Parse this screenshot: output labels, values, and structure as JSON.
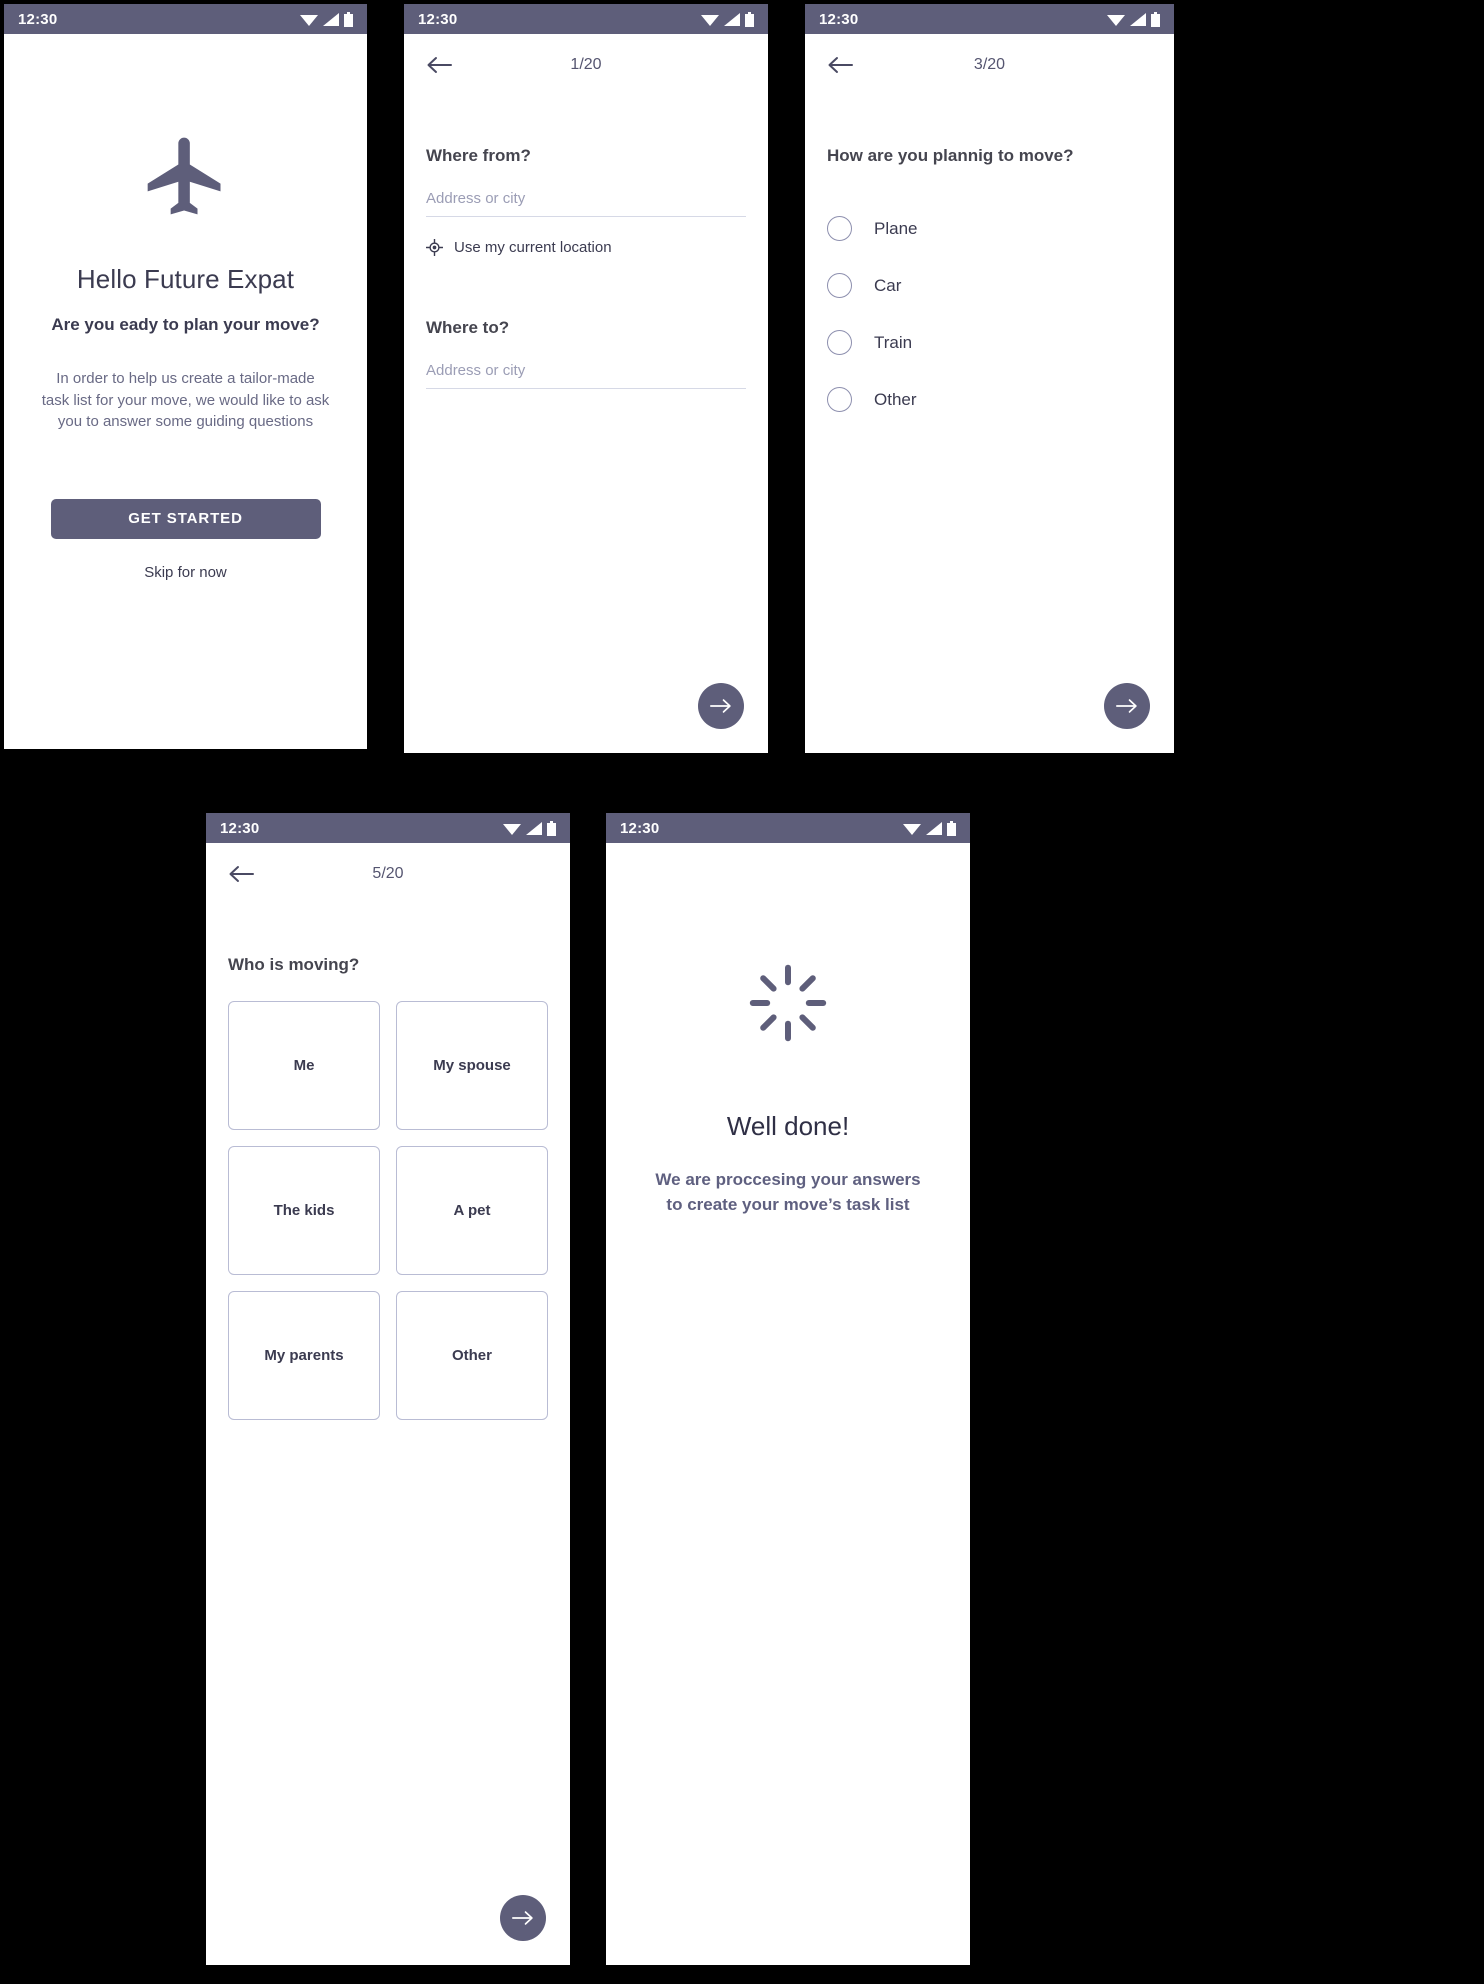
{
  "theme": {
    "accent": "#5e5e7a",
    "statusbar_bg": "#5e5e7a",
    "text_dark": "#3b3b50",
    "text_muted": "#696a85",
    "border": "#b9bcd4",
    "page_bg": "#ffffff",
    "canvas_bg": "#000000"
  },
  "status_bar": {
    "time": "12:30",
    "icons": [
      "wifi-icon",
      "signal-icon",
      "battery-icon"
    ]
  },
  "screens": {
    "welcome": {
      "hero_icon": "airplane-icon",
      "title": "Hello Future Expat",
      "subtitle": "Are you eady to plan your move?",
      "paragraph": "In order to help us create a tailor-made task list for your move, we would like to ask you to answer some guiding questions",
      "primary_button": "GET STARTED",
      "skip_link": "Skip for now"
    },
    "where": {
      "counter": "1/20",
      "back_icon": "arrow-left-icon",
      "question_from": "Where from?",
      "placeholder_from": "Address or city",
      "value_from": "",
      "current_location_icon": "my-location-icon",
      "current_location_label": "Use my current location",
      "question_to": "Where to?",
      "placeholder_to": "Address or city",
      "value_to": "",
      "next_icon": "arrow-right-icon"
    },
    "transport": {
      "counter": "3/20",
      "back_icon": "arrow-left-icon",
      "question": "How are you plannig to move?",
      "options": [
        {
          "label": "Plane",
          "selected": false
        },
        {
          "label": "Car",
          "selected": false
        },
        {
          "label": "Train",
          "selected": false
        },
        {
          "label": "Other",
          "selected": false
        }
      ],
      "next_icon": "arrow-right-icon"
    },
    "who": {
      "counter": "5/20",
      "back_icon": "arrow-left-icon",
      "question": "Who is moving?",
      "options": [
        {
          "label": "Me"
        },
        {
          "label": "My spouse"
        },
        {
          "label": "The kids"
        },
        {
          "label": "A pet"
        },
        {
          "label": "My parents"
        },
        {
          "label": "Other"
        }
      ],
      "next_icon": "arrow-right-icon"
    },
    "done": {
      "spinner_icon": "loading-spinner-icon",
      "title": "Well done!",
      "message": "We are proccesing your answers to create your move’s task list"
    }
  }
}
